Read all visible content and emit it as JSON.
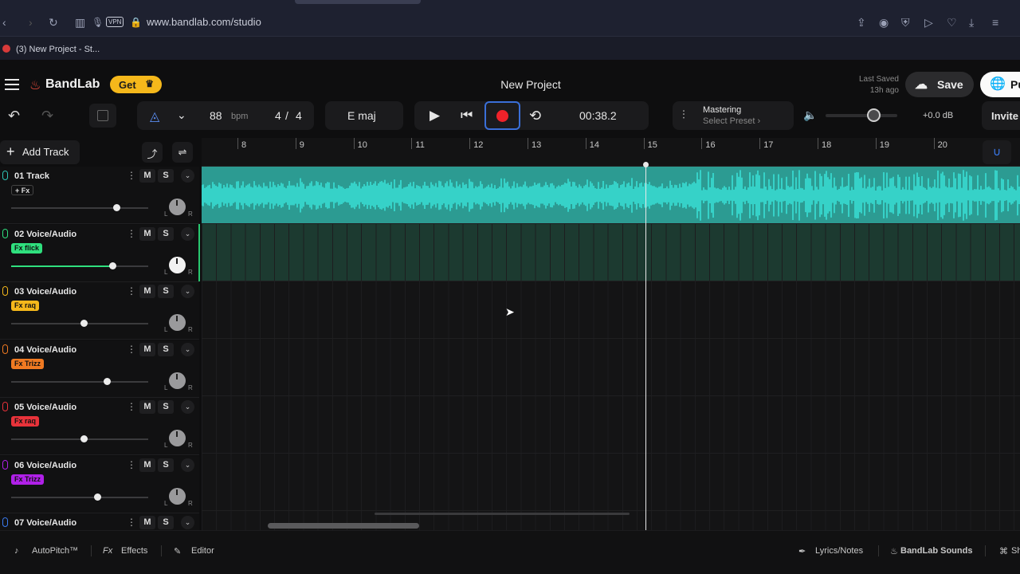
{
  "browser": {
    "url": "www.bandlab.com/studio",
    "vpn_label": "VPN",
    "tab_title": "(3) New Project - St..."
  },
  "header": {
    "logo_text": "BandLab",
    "get_label": "Get",
    "project_title": "New Project",
    "last_saved_label": "Last Saved",
    "last_saved_value": "13h ago",
    "save_label": "Save",
    "publish_label": "Pu"
  },
  "toolbar": {
    "bpm_value": "88",
    "bpm_unit": "bpm",
    "time_sig_num": "4",
    "time_sig_sep": "/",
    "time_sig_den": "4",
    "key": "E maj",
    "time": "00:38.2",
    "mastering_title": "Mastering",
    "mastering_preset": "Select Preset ›",
    "volume_db": "+0.0 dB",
    "volume_level": 0.6,
    "invite_label": "Invite"
  },
  "sidebar": {
    "add_track_label": "Add Track"
  },
  "tracks": [
    {
      "name": "01  Track",
      "fx": "+ Fx",
      "fx_color": "transparent",
      "mic_color": "#2ec4b6",
      "fader": 0.77
    },
    {
      "name": "02  Voice/Audio",
      "fx": "Fx flick",
      "fx_color": "#2fe07e",
      "mic_color": "#2fe07e",
      "fader": 0.74
    },
    {
      "name": "03  Voice/Audio",
      "fx": "Fx raq",
      "fx_color": "#f5b81b",
      "mic_color": "#f5b81b",
      "fader": 0.53
    },
    {
      "name": "04  Voice/Audio",
      "fx": "Fx Trizz",
      "fx_color": "#f07a22",
      "mic_color": "#f07a22",
      "fader": 0.7
    },
    {
      "name": "05  Voice/Audio",
      "fx": "Fx raq",
      "fx_color": "#e8323a",
      "mic_color": "#e8323a",
      "fader": 0.53
    },
    {
      "name": "06  Voice/Audio",
      "fx": "Fx Trizz",
      "fx_color": "#b020e8",
      "mic_color": "#b020e8",
      "fader": 0.63
    },
    {
      "name": "07  Voice/Audio",
      "fx": "",
      "fx_color": "transparent",
      "mic_color": "#3a7bf0",
      "fader": 0.5
    }
  ],
  "track_buttons": {
    "mute": "M",
    "solo": "S"
  },
  "knob_labels": {
    "left": "L",
    "right": "R"
  },
  "ruler": [
    "8",
    "9",
    "10",
    "11",
    "12",
    "13",
    "14",
    "15",
    "16",
    "17",
    "18",
    "19",
    "20"
  ],
  "footer": {
    "autopitch": "AutoPitch™",
    "effects": "Effects",
    "editor": "Editor",
    "lyrics": "Lyrics/Notes",
    "sounds": "BandLab Sounds",
    "shortcuts": "Sh"
  },
  "colors": {
    "accent_blue": "#3a6fd8",
    "record_red": "#f0222a",
    "waveform": "#39e0d6",
    "clip_bg": "#2c9b92",
    "get_yellow": "#f5b81b"
  }
}
